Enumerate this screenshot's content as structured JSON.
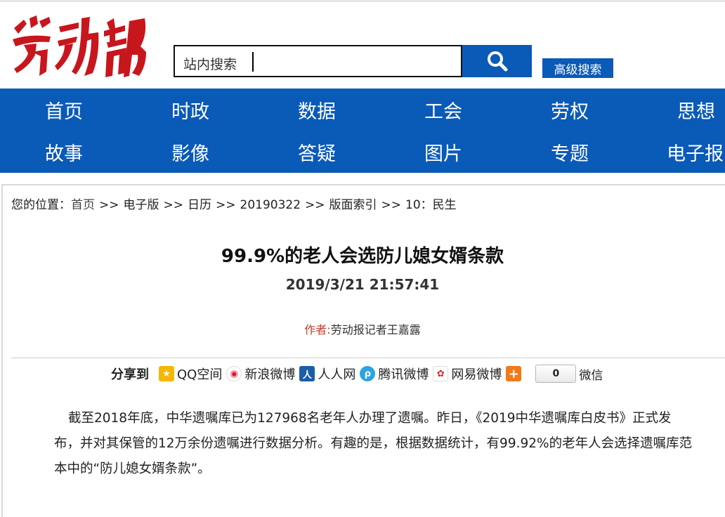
{
  "logo": {
    "text": "劳动报",
    "color": "#c8161d"
  },
  "search": {
    "placeholder": "站内搜索",
    "advanced_label": "高级搜索"
  },
  "nav": {
    "row1": [
      "首页",
      "时政",
      "数据",
      "工会",
      "劳权",
      "思想"
    ],
    "row2": [
      "故事",
      "影像",
      "答疑",
      "图片",
      "专题",
      "电子报"
    ]
  },
  "breadcrumb": {
    "prefix": "您的位置：",
    "items": [
      "首页",
      "电子版",
      "日历",
      "20190322",
      "版面索引",
      "10：民生"
    ],
    "separator": ">>"
  },
  "article": {
    "title": "99.9%的老人会选防儿媳女婿条款",
    "date": "2019/3/21 21:57:41",
    "author_label": "作者:",
    "author": "劳动报记者王嘉露",
    "body": "截至2018年底，中华遗嘱库已为127968名老年人办理了遗嘱。昨日，《2019中华遗嘱库白皮书》正式发布，并对其保管的12万余份遗嘱进行数据分析。有趣的是，根据数据统计，有99.92%的老年人会选择遗嘱库范本中的“防儿媳女婿条款”。"
  },
  "share": {
    "label": "分享到",
    "items": [
      {
        "label": "QQ空间",
        "icon": "qzone-icon",
        "color": "#f5b800"
      },
      {
        "label": "新浪微博",
        "icon": "weibo-icon",
        "color": "#e6162d"
      },
      {
        "label": "人人网",
        "icon": "renren-icon",
        "color": "#1c5da9"
      },
      {
        "label": "腾讯微博",
        "icon": "tencent-weibo-icon",
        "color": "#2ba4e0"
      },
      {
        "label": "网易微博",
        "icon": "netease-weibo-icon",
        "color": "#d8262e"
      }
    ],
    "count": "0",
    "weixin_label": "微信"
  },
  "colors": {
    "brand_blue": "#0a5ab8",
    "brand_red": "#c8161d"
  }
}
